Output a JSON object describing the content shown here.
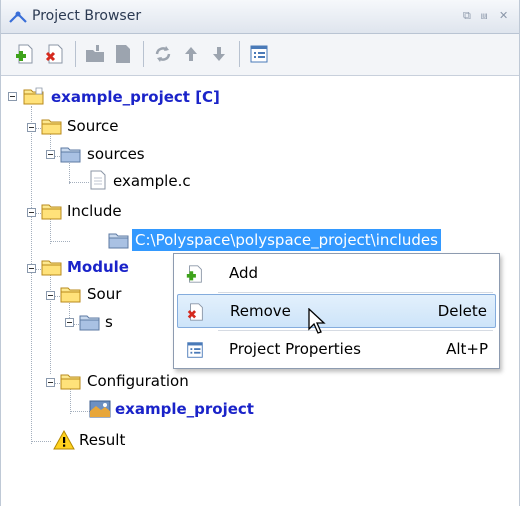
{
  "window": {
    "title": "Project Browser",
    "controls": [
      "restore-icon",
      "pin-icon",
      "close-icon"
    ],
    "colors": {
      "selection": "#3399ff",
      "project_text": "#1a23c9"
    }
  },
  "toolbar": {
    "buttons": [
      "add-icon",
      "remove-icon",
      "new-folder-icon",
      "new-file-icon",
      "refresh-icon",
      "move-up-icon",
      "move-down-icon",
      "properties-icon"
    ]
  },
  "tree": {
    "project": "example_project [C]",
    "source": "Source",
    "sources": "sources",
    "file": "example.c",
    "include": "Include",
    "include_path": "C:\\Polyspace\\polyspace_project\\includes",
    "module": "Module",
    "module_source": "Sour",
    "module_sources": "s",
    "configuration": "Configuration",
    "config_project": "example_project",
    "result": "Result"
  },
  "context_menu": {
    "items": [
      {
        "label": "Add",
        "shortcut": "",
        "icon": "add-icon"
      },
      {
        "label": "Remove",
        "shortcut": "Delete",
        "icon": "remove-icon",
        "hover": true
      },
      {
        "label": "Project Properties",
        "shortcut": "Alt+P",
        "icon": "properties-icon"
      }
    ]
  }
}
